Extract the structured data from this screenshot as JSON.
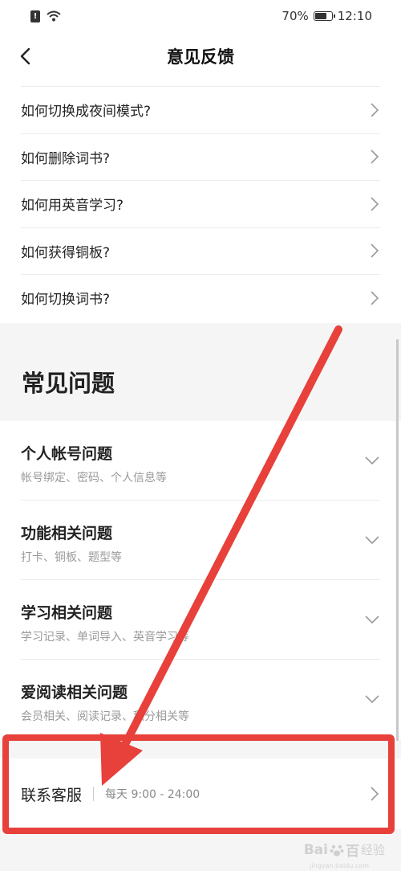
{
  "status": {
    "sim_label": "!",
    "battery_percent_text": "70%",
    "battery_level": 0.7,
    "time": "12:10"
  },
  "nav": {
    "title": "意见反馈"
  },
  "faq": [
    {
      "label": "如何切换成夜间模式?"
    },
    {
      "label": "如何删除词书?"
    },
    {
      "label": "如何用英音学习?"
    },
    {
      "label": "如何获得铜板?"
    },
    {
      "label": "如何切换词书?"
    }
  ],
  "section": {
    "title": "常见问题"
  },
  "categories": [
    {
      "title": "个人帐号问题",
      "subtitle": "帐号绑定、密码、个人信息等"
    },
    {
      "title": "功能相关问题",
      "subtitle": "打卡、铜板、题型等"
    },
    {
      "title": "学习相关问题",
      "subtitle": "学习记录、单词导入、英音学习等"
    },
    {
      "title": "爱阅读相关问题",
      "subtitle": "会员相关、阅读记录、积分相关等"
    }
  ],
  "contact": {
    "label": "联系客服",
    "hours": "每天 9:00 - 24:00"
  },
  "watermark": {
    "brand": "Bai",
    "brand_end": "百",
    "sub": "经验",
    "url": "jingyan.baidu.com"
  },
  "colors": {
    "annotation_red": "#e8403a",
    "band_gray": "#f5f5f5"
  }
}
